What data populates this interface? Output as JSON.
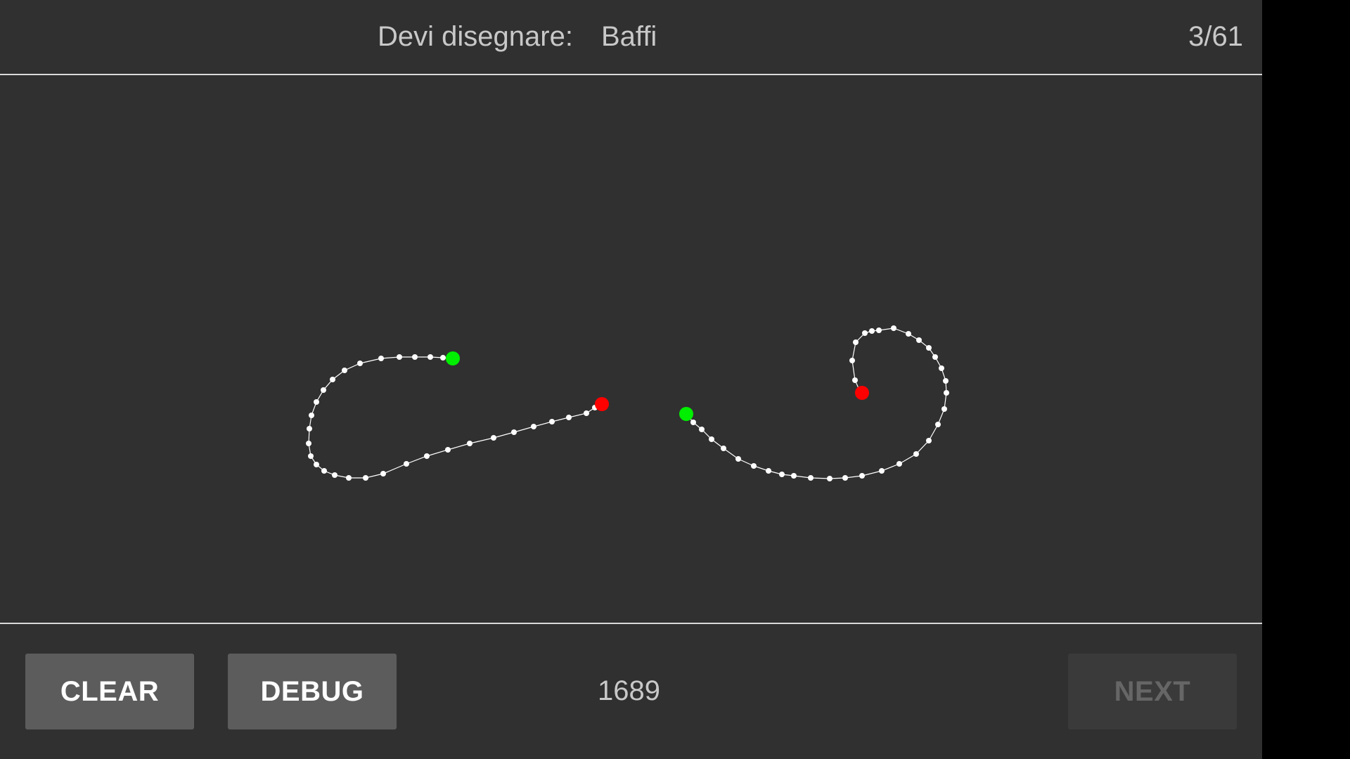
{
  "header": {
    "prompt_label": "Devi disegnare:",
    "prompt_word": "Baffi",
    "counter": "3/61"
  },
  "footer": {
    "clear_label": "CLEAR",
    "debug_label": "DEBUG",
    "score": "1689",
    "next_label": "NEXT"
  },
  "colors": {
    "background": "#303030",
    "stroke": "#ffffff",
    "start_point": "#00ee00",
    "end_point": "#ff0000",
    "divider": "#d9d9d9"
  },
  "strokes": [
    {
      "name": "left-stroke",
      "start": "green",
      "end": "red"
    },
    {
      "name": "right-stroke",
      "start": "green",
      "end": "red"
    }
  ]
}
